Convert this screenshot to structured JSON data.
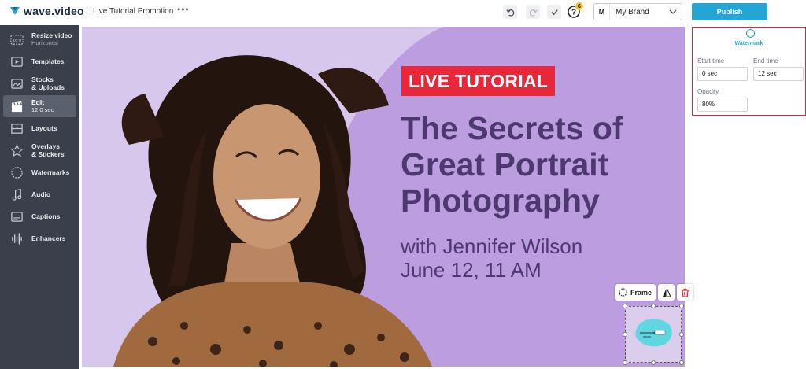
{
  "app": {
    "logo_text": "wave.video",
    "project_title": "Live Tutorial Promotion",
    "more_icon": "ellipsis-icon",
    "help_badge": "6",
    "brand_initial": "M",
    "brand_name": "My Brand",
    "publish_label": "Publish",
    "accent_color": "#23a6d5"
  },
  "sidebar": {
    "items": [
      {
        "label": "Resize video",
        "sub": "Horizontal",
        "icon": "aspect-ratio-icon",
        "icon_text": "16:9"
      },
      {
        "label": "Templates",
        "sub": "",
        "icon": "templates-icon"
      },
      {
        "label": "Stocks",
        "sub": "& Uploads",
        "icon": "image-icon"
      },
      {
        "label": "Edit",
        "sub": "12.0 sec",
        "icon": "clapperboard-icon"
      },
      {
        "label": "Layouts",
        "sub": "",
        "icon": "layouts-icon"
      },
      {
        "label": "Overlays",
        "sub": "& Stickers",
        "icon": "star-icon"
      },
      {
        "label": "Watermarks",
        "sub": "",
        "icon": "watermark-icon"
      },
      {
        "label": "Audio",
        "sub": "",
        "icon": "music-note-icon"
      },
      {
        "label": "Captions",
        "sub": "",
        "icon": "captions-icon"
      },
      {
        "label": "Enhancers",
        "sub": "",
        "icon": "waveform-icon"
      }
    ]
  },
  "canvas": {
    "badge": "LIVE TUTORIAL",
    "headline_1": "The Secrets of",
    "headline_2": "Great Portrait",
    "headline_3": "Photography",
    "presenter": "with Jennifer Wilson",
    "date": "June 12, 11 AM",
    "badge_color": "#e8283a",
    "text_color": "#4e3870"
  },
  "watermark_tools": {
    "frame_label": "Frame"
  },
  "right_panel": {
    "title": "Watermark",
    "start_label": "Start time",
    "start_value": "0 sec",
    "end_label": "End time",
    "end_value": "12 sec",
    "opacity_label": "Opacity",
    "opacity_value": "80%"
  }
}
